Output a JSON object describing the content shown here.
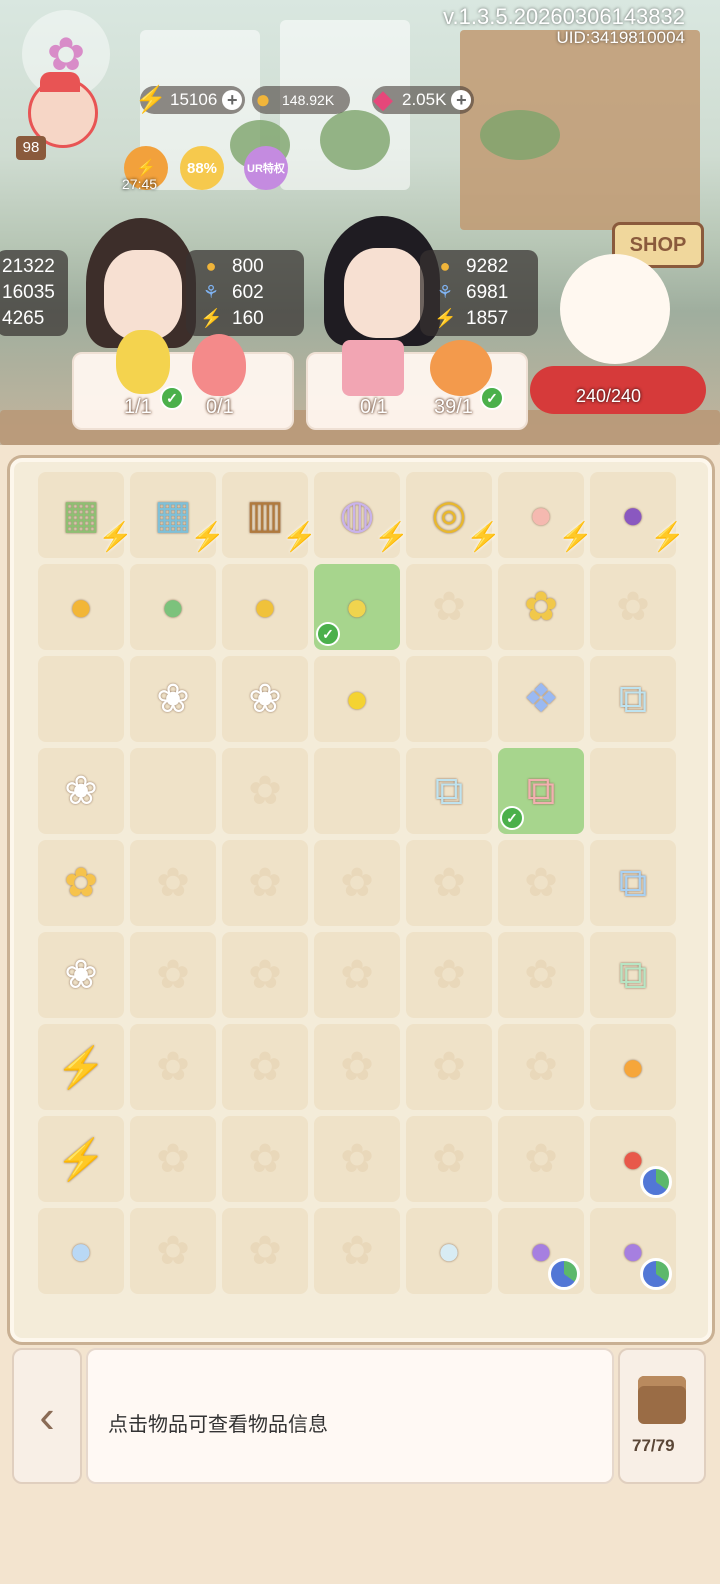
{
  "header": {
    "version": "v.1.3.5.20260306143832",
    "uid": "UID:3419810004"
  },
  "resources": [
    {
      "name": "energy",
      "value": "15106",
      "icon": "lightning-icon"
    },
    {
      "name": "coins",
      "value": "148.92K",
      "icon": "coin-icon"
    },
    {
      "name": "gems",
      "value": "2.05K",
      "icon": "gem-icon"
    }
  ],
  "player": {
    "level": "98"
  },
  "boosts": [
    {
      "label": "27:45"
    },
    {
      "label": "88%"
    },
    {
      "label": "UR特权"
    }
  ],
  "left_partial": [
    "21322",
    "16035",
    "4265"
  ],
  "customers": [
    {
      "stats": [
        "800",
        "602",
        "160"
      ],
      "orders": [
        "1/1",
        "0/1"
      ]
    },
    {
      "stats": [
        "9282",
        "6981",
        "1857"
      ],
      "orders": [
        "0/1",
        "39/1"
      ]
    }
  ],
  "shop": {
    "sign": "SHOP",
    "counter": "240/240"
  },
  "board": {
    "rows": [
      [
        "greenhouse",
        "crystal-house",
        "cabinet",
        "dessert-plate",
        "vortex",
        "cat-tart",
        "teapot"
      ],
      [
        "mango-creature",
        "melon",
        "pineapple",
        "pineapple-selected",
        "empty",
        "ylang-flower",
        "empty"
      ],
      [
        "blank",
        "lily",
        "calla-lily",
        "lemon",
        "blank",
        "butterfly-badge",
        "vine-jar"
      ],
      [
        "magnolia",
        "blank",
        "empty",
        "blank",
        "vine-jar",
        "mushroom-jar",
        "blank"
      ],
      [
        "yellow-flower",
        "empty",
        "empty",
        "empty",
        "empty",
        "empty",
        "blue-jar"
      ],
      [
        "white-flower",
        "empty",
        "empty",
        "empty",
        "empty",
        "empty",
        "green-jar"
      ],
      [
        "energy-orb",
        "empty",
        "empty",
        "empty",
        "empty",
        "empty",
        "fire-drop"
      ],
      [
        "energy-shards",
        "empty",
        "empty",
        "empty",
        "empty",
        "empty",
        "potion-red"
      ],
      [
        "rainbow-drop",
        "empty",
        "empty",
        "empty",
        "water-drop",
        "potion-purple",
        "potion-purple"
      ]
    ]
  },
  "bottom": {
    "back_icon": "chevron-left-icon",
    "info_text": "点击物品可查看物品信息",
    "bag_count": "77/79"
  }
}
